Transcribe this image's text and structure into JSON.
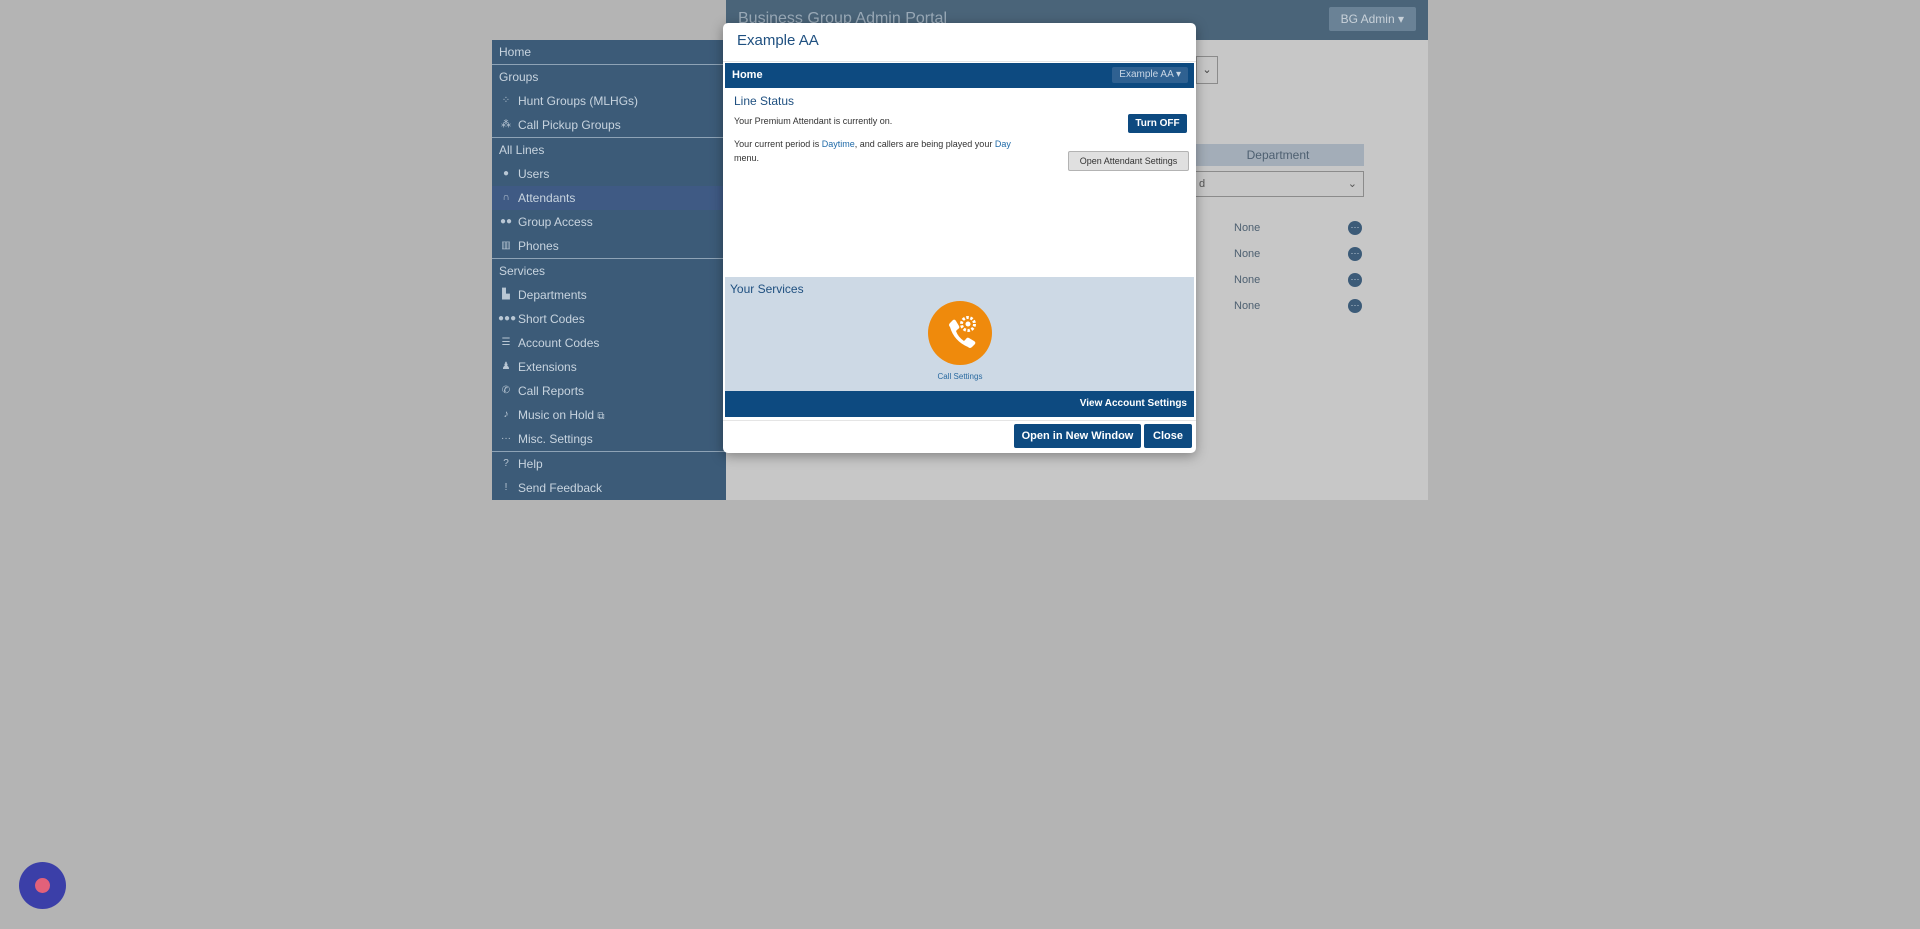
{
  "app": {
    "title": "Business Group Admin Portal",
    "user_menu": "BG Admin ▾"
  },
  "sidebar": {
    "home": "Home",
    "groups_header": "Groups",
    "hunt_groups": "Hunt Groups (MLHGs)",
    "call_pickup": "Call Pickup Groups",
    "all_lines_header": "All Lines",
    "users": "Users",
    "attendants": "Attendants",
    "group_access": "Group Access",
    "phones": "Phones",
    "services_header": "Services",
    "departments": "Departments",
    "short_codes": "Short Codes",
    "account_codes": "Account Codes",
    "extensions": "Extensions",
    "call_reports": "Call Reports",
    "music_on_hold": "Music on Hold",
    "misc_settings": "Misc. Settings",
    "help": "Help",
    "send_feedback": "Send Feedback"
  },
  "background_table": {
    "column_header": "Department",
    "filter_value": "d",
    "rows": [
      "None",
      "None",
      "None",
      "None"
    ]
  },
  "modal": {
    "title": "Example AA",
    "home_label": "Home",
    "aa_dropdown": "Example AA ▾",
    "line_status_title": "Line Status",
    "status_text": "Your Premium Attendant is currently on.",
    "period_prefix": "Your current period is ",
    "period_name": "Daytime",
    "period_mid": ", and callers are being played your ",
    "menu_name": "Day",
    "period_suffix": " menu.",
    "turn_off_label": "Turn OFF",
    "open_settings_label": "Open Attendant Settings",
    "services_title": "Your Services",
    "call_settings_label": "Call Settings",
    "view_account_label": "View Account Settings",
    "open_new_window_label": "Open in New Window",
    "close_label": "Close"
  }
}
